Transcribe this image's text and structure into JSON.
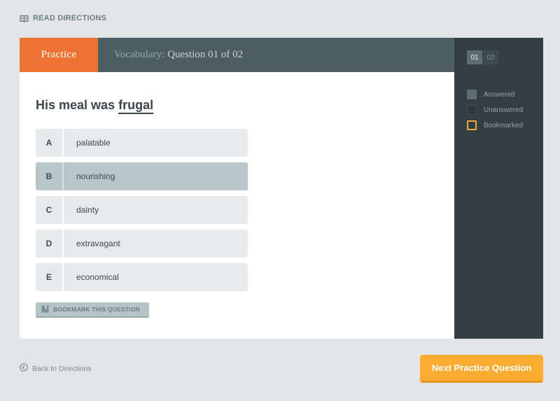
{
  "top_link": {
    "label": "READ DIRECTIONS",
    "icon": "book-icon"
  },
  "header": {
    "mode": "Practice",
    "section": "Vocabulary:",
    "question_counter": "Question 01 of 02"
  },
  "question": {
    "prefix": "His meal was",
    "target_word": "frugal"
  },
  "answers": [
    {
      "letter": "A",
      "text": "palatable",
      "selected": false
    },
    {
      "letter": "B",
      "text": "nourishing",
      "selected": true
    },
    {
      "letter": "C",
      "text": "dainty",
      "selected": false
    },
    {
      "letter": "D",
      "text": "extravagant",
      "selected": false
    },
    {
      "letter": "E",
      "text": "economical",
      "selected": false
    }
  ],
  "bookmark_button": {
    "label": "BOOKMARK THIS QUESTION",
    "icon": "bookmark-icon"
  },
  "sidebar": {
    "question_numbers": [
      {
        "label": "01",
        "active": true
      },
      {
        "label": "02",
        "active": false
      }
    ],
    "legend": [
      {
        "label": "Answered",
        "state": "answered"
      },
      {
        "label": "Unanswered",
        "state": "unanswered"
      },
      {
        "label": "Bookmarked",
        "state": "bookmarked"
      }
    ]
  },
  "footer": {
    "back_label": "Back to Directions",
    "back_icon": "circle-chevron-left-icon",
    "next_label": "Next Practice Question"
  },
  "colors": {
    "accent_orange": "#ec7332",
    "next_button": "#f9ac2f",
    "sidebar_bg": "#343f42",
    "header_bg": "#4e5d63",
    "selected_answer": "#b9c6c9",
    "bookmark_outline": "#e9a542"
  }
}
